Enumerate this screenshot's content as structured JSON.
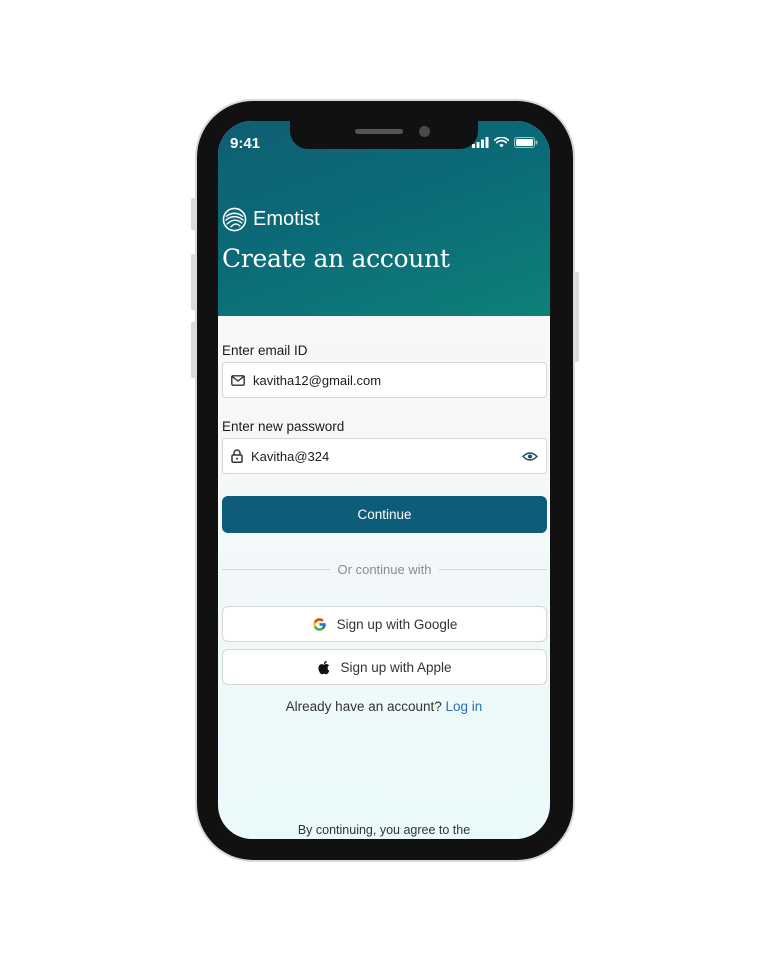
{
  "status_bar": {
    "time": "9:41"
  },
  "brand": {
    "name": "Emotist"
  },
  "header": {
    "title": "Create an account"
  },
  "email": {
    "label": "Enter email ID",
    "value": "kavitha12@gmail.com"
  },
  "password": {
    "label": "Enter new password",
    "value": "Kavitha@324"
  },
  "continue_label": "Continue",
  "divider_text": "Or continue with",
  "google_button": {
    "label": "Sign up with Google"
  },
  "apple_button": {
    "label": "Sign up with Apple"
  },
  "login_prompt": {
    "text": "Already have an account?",
    "link": "Log in"
  },
  "terms_text": "By continuing, you agree to the",
  "colors": {
    "primary": "#0d5d7a",
    "header_start": "#0f5f73",
    "header_end": "#0d8178",
    "link": "#2f6fb5"
  }
}
